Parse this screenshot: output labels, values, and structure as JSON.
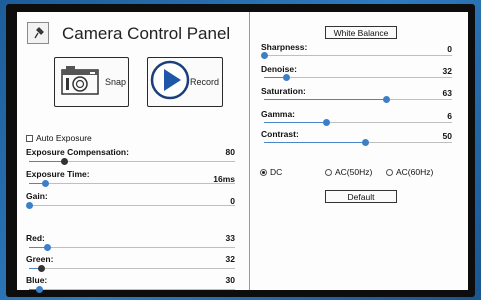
{
  "app": {
    "title": "Camera Control Panel"
  },
  "buttons": {
    "snap": "Snap",
    "record": "Record",
    "white_balance": "White Balance",
    "default": "Default"
  },
  "auto_exposure": {
    "label": "Auto Exposure",
    "checked": false
  },
  "left_sliders": [
    {
      "label": "Exposure Compensation:",
      "value": "80",
      "fraction": 0.17,
      "thumb": "dark"
    },
    {
      "label": "Exposure Time:",
      "value": "16ms",
      "fraction": 0.08,
      "thumb": "blue"
    },
    {
      "label": "Gain:",
      "value": "0",
      "fraction": 0.0,
      "thumb": "blue"
    },
    {
      "label": "Red:",
      "value": "33",
      "fraction": 0.09,
      "thumb": "blue"
    },
    {
      "label": "Green:",
      "value": "32",
      "fraction": 0.06,
      "thumb": "dark"
    },
    {
      "label": "Blue:",
      "value": "30",
      "fraction": 0.05,
      "thumb": "blue"
    }
  ],
  "right_sliders": [
    {
      "label": "Sharpness:",
      "value": "0",
      "fraction": 0.0,
      "thumb": "blue"
    },
    {
      "label": "Denoise:",
      "value": "32",
      "fraction": 0.12,
      "thumb": "blue"
    },
    {
      "label": "Saturation:",
      "value": "63",
      "fraction": 0.65,
      "thumb": "blue"
    },
    {
      "label": "Gamma:",
      "value": "6",
      "fraction": 0.33,
      "thumb": "blue"
    },
    {
      "label": "Contrast:",
      "value": "50",
      "fraction": 0.54,
      "thumb": "blue"
    }
  ],
  "power_frequency": {
    "options": [
      {
        "label": "DC",
        "checked": true
      },
      {
        "label": "AC(50Hz)",
        "checked": false
      },
      {
        "label": "AC(60Hz)",
        "checked": false
      }
    ]
  },
  "colors": {
    "accent": "#3d7fc6",
    "thumb_dark": "#333333",
    "background": "#2e7bbf"
  }
}
